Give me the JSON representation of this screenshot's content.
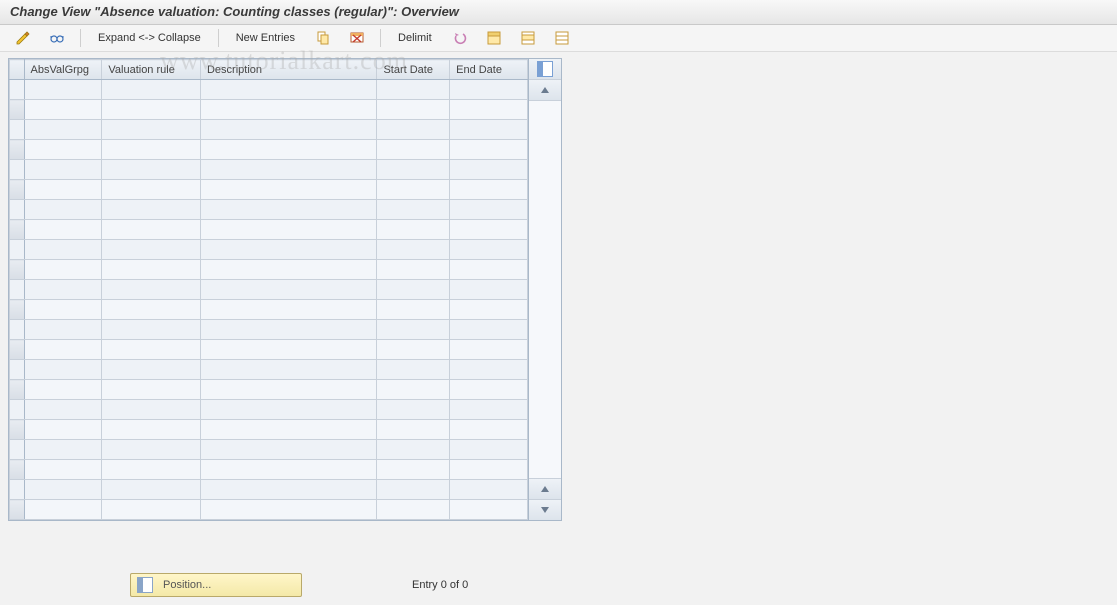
{
  "title": "Change View \"Absence valuation: Counting classes (regular)\": Overview",
  "toolbar": {
    "expand_collapse_label": "Expand <-> Collapse",
    "new_entries_label": "New Entries",
    "delimit_label": "Delimit",
    "icons": {
      "display_change": "pencil-glasses-icon",
      "other_entry": "glasses-icon",
      "copy": "copy-icon",
      "delete": "delete-icon",
      "undo": "undo-icon",
      "select_all": "select-all-icon",
      "select_block": "select-block-icon",
      "deselect": "deselect-icon"
    }
  },
  "table": {
    "columns": [
      "AbsValGrpg",
      "Valuation rule",
      "Description",
      "Start Date",
      "End Date"
    ],
    "rows": [
      {
        "grpg": "",
        "rule": "",
        "desc": "",
        "start": "",
        "end": ""
      },
      {
        "grpg": "",
        "rule": "",
        "desc": "",
        "start": "",
        "end": ""
      },
      {
        "grpg": "",
        "rule": "",
        "desc": "",
        "start": "",
        "end": ""
      },
      {
        "grpg": "",
        "rule": "",
        "desc": "",
        "start": "",
        "end": ""
      },
      {
        "grpg": "",
        "rule": "",
        "desc": "",
        "start": "",
        "end": ""
      },
      {
        "grpg": "",
        "rule": "",
        "desc": "",
        "start": "",
        "end": ""
      },
      {
        "grpg": "",
        "rule": "",
        "desc": "",
        "start": "",
        "end": ""
      },
      {
        "grpg": "",
        "rule": "",
        "desc": "",
        "start": "",
        "end": ""
      },
      {
        "grpg": "",
        "rule": "",
        "desc": "",
        "start": "",
        "end": ""
      },
      {
        "grpg": "",
        "rule": "",
        "desc": "",
        "start": "",
        "end": ""
      },
      {
        "grpg": "",
        "rule": "",
        "desc": "",
        "start": "",
        "end": ""
      },
      {
        "grpg": "",
        "rule": "",
        "desc": "",
        "start": "",
        "end": ""
      },
      {
        "grpg": "",
        "rule": "",
        "desc": "",
        "start": "",
        "end": ""
      },
      {
        "grpg": "",
        "rule": "",
        "desc": "",
        "start": "",
        "end": ""
      },
      {
        "grpg": "",
        "rule": "",
        "desc": "",
        "start": "",
        "end": ""
      },
      {
        "grpg": "",
        "rule": "",
        "desc": "",
        "start": "",
        "end": ""
      },
      {
        "grpg": "",
        "rule": "",
        "desc": "",
        "start": "",
        "end": ""
      },
      {
        "grpg": "",
        "rule": "",
        "desc": "",
        "start": "",
        "end": ""
      },
      {
        "grpg": "",
        "rule": "",
        "desc": "",
        "start": "",
        "end": ""
      },
      {
        "grpg": "",
        "rule": "",
        "desc": "",
        "start": "",
        "end": ""
      },
      {
        "grpg": "",
        "rule": "",
        "desc": "",
        "start": "",
        "end": ""
      },
      {
        "grpg": "",
        "rule": "",
        "desc": "",
        "start": "",
        "end": ""
      }
    ]
  },
  "footer": {
    "position_label": "Position...",
    "entry_label": "Entry 0 of 0"
  },
  "watermark": "www.tutorialkart.com"
}
